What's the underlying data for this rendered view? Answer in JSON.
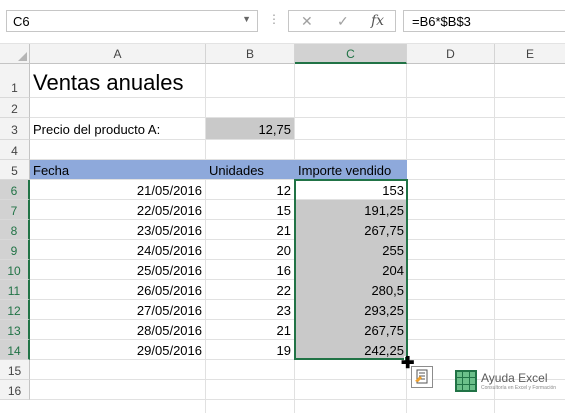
{
  "name_box": {
    "value": "C6"
  },
  "formula_bar": {
    "formula": "=B6*$B$3",
    "cancel_glyph": "✕",
    "enter_glyph": "✓",
    "fx_glyph": "fx"
  },
  "columns": [
    "A",
    "B",
    "C",
    "D",
    "E"
  ],
  "selected_column": "C",
  "rows": [
    "1",
    "2",
    "3",
    "4",
    "5",
    "6",
    "7",
    "8",
    "9",
    "10",
    "11",
    "12",
    "13",
    "14",
    "15",
    "16"
  ],
  "sheet": {
    "title": "Ventas anuales",
    "price_label": "Precio del producto A:",
    "price_value": "12,75",
    "headers": {
      "fecha": "Fecha",
      "unidades": "Unidades",
      "importe": "Importe vendido"
    },
    "data": [
      {
        "fecha": "21/05/2016",
        "unidades": "12",
        "importe": "153"
      },
      {
        "fecha": "22/05/2016",
        "unidades": "15",
        "importe": "191,25"
      },
      {
        "fecha": "23/05/2016",
        "unidades": "21",
        "importe": "267,75"
      },
      {
        "fecha": "24/05/2016",
        "unidades": "20",
        "importe": "255"
      },
      {
        "fecha": "25/05/2016",
        "unidades": "16",
        "importe": "204"
      },
      {
        "fecha": "26/05/2016",
        "unidades": "22",
        "importe": "280,5"
      },
      {
        "fecha": "27/05/2016",
        "unidades": "23",
        "importe": "293,25"
      },
      {
        "fecha": "28/05/2016",
        "unidades": "21",
        "importe": "267,75"
      },
      {
        "fecha": "29/05/2016",
        "unidades": "19",
        "importe": "242,25"
      }
    ]
  },
  "watermark": {
    "brand": "Ayuda Excel",
    "tagline": "Consultoría en Excel y Formación"
  },
  "colors": {
    "accent": "#217346",
    "header_fill": "#8ea9db",
    "gray_fill": "#c9c9c9"
  }
}
